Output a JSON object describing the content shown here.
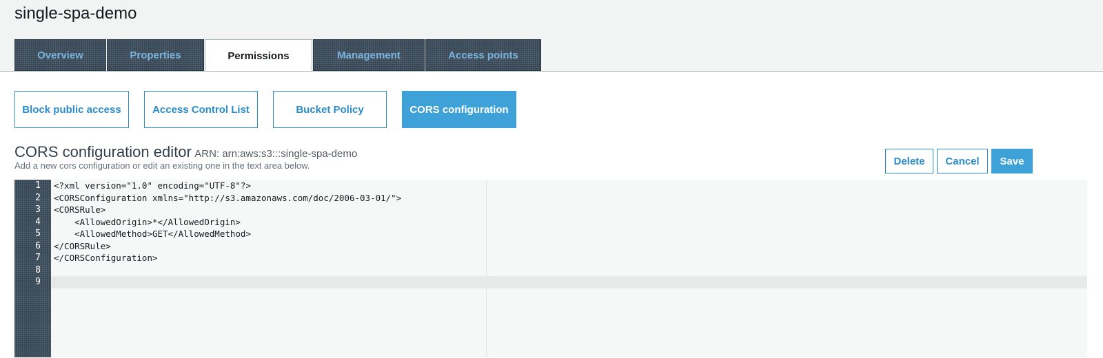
{
  "bucket": {
    "name": "single-spa-demo"
  },
  "tabs": [
    {
      "label": "Overview",
      "active": false
    },
    {
      "label": "Properties",
      "active": false
    },
    {
      "label": "Permissions",
      "active": true
    },
    {
      "label": "Management",
      "active": false
    },
    {
      "label": "Access points",
      "active": false
    }
  ],
  "subtabs": [
    {
      "label": "Block public access",
      "active": false
    },
    {
      "label": "Access Control List",
      "active": false
    },
    {
      "label": "Bucket Policy",
      "active": false
    },
    {
      "label": "CORS configuration",
      "active": true
    }
  ],
  "editor": {
    "title": "CORS configuration editor",
    "arn": "ARN: arn:aws:s3:::single-spa-demo",
    "description": "Add a new cors configuration or edit an existing one in the text area below."
  },
  "actions": {
    "delete_label": "Delete",
    "cancel_label": "Cancel",
    "save_label": "Save"
  },
  "code": {
    "line_numbers": [
      "1",
      "2",
      "3",
      "4",
      "5",
      "6",
      "7",
      "8",
      "9"
    ],
    "lines": [
      "<?xml version=\"1.0\" encoding=\"UTF-8\"?>",
      "<CORSConfiguration xmlns=\"http://s3.amazonaws.com/doc/2006-03-01/\">",
      "<CORSRule>",
      "    <AllowedOrigin>*</AllowedOrigin>",
      "    <AllowedMethod>GET</AllowedMethod>",
      "</CORSRule>",
      "</CORSConfiguration>",
      "",
      ""
    ],
    "active_line": 9
  },
  "colors": {
    "accent": "#3ea2d9",
    "link": "#2b8ccc",
    "tab_dark": "#3b4a58"
  }
}
